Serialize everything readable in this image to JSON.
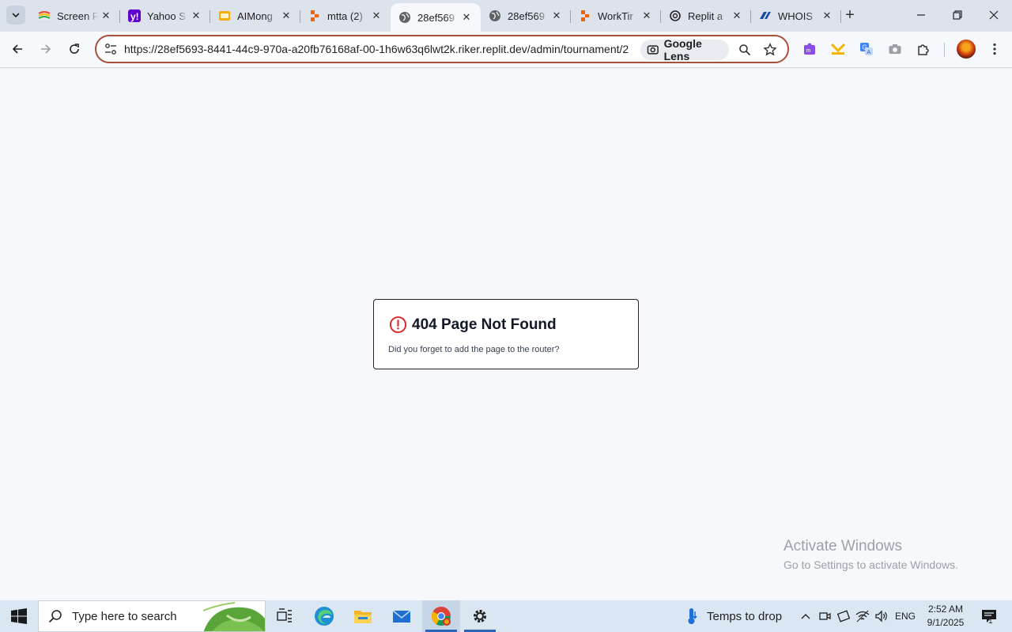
{
  "browser": {
    "tabs": [
      {
        "title": "Screen R",
        "favicon": "screen-recorder-icon",
        "active": false
      },
      {
        "title": "Yahoo S",
        "favicon": "yahoo-icon",
        "active": false
      },
      {
        "title": "AIMong",
        "favicon": "aimong-icon",
        "active": false
      },
      {
        "title": "mtta (2)",
        "favicon": "replit-icon",
        "active": false
      },
      {
        "title": "28ef569",
        "favicon": "globe-icon",
        "active": true
      },
      {
        "title": "28ef569",
        "favicon": "globe-icon",
        "active": false
      },
      {
        "title": "WorkTir",
        "favicon": "replit-icon",
        "active": false
      },
      {
        "title": "Replit a",
        "favicon": "openai-icon",
        "active": false
      },
      {
        "title": "WHOIS",
        "favicon": "whois-icon",
        "active": false
      }
    ],
    "url": "https://28ef5693-8441-44c9-970a-a20fb76168af-00-1h6w63q6lwt2k.riker.replit.dev/admin/tournament/2",
    "lens_label": "Google Lens"
  },
  "page": {
    "error_title": "404 Page Not Found",
    "error_message": "Did you forget to add the page to the router?"
  },
  "watermark": {
    "line1": "Activate Windows",
    "line2": "Go to Settings to activate Windows."
  },
  "taskbar": {
    "search_placeholder": "Type here to search",
    "weather_text": "Temps to drop",
    "language": "ENG",
    "time": "2:52 AM",
    "date": "9/1/2025",
    "notification_count": "1"
  },
  "colors": {
    "error_red": "#dc2626",
    "omnibox_border": "#a8503a",
    "taskbar_bg": "#dae6f2"
  }
}
